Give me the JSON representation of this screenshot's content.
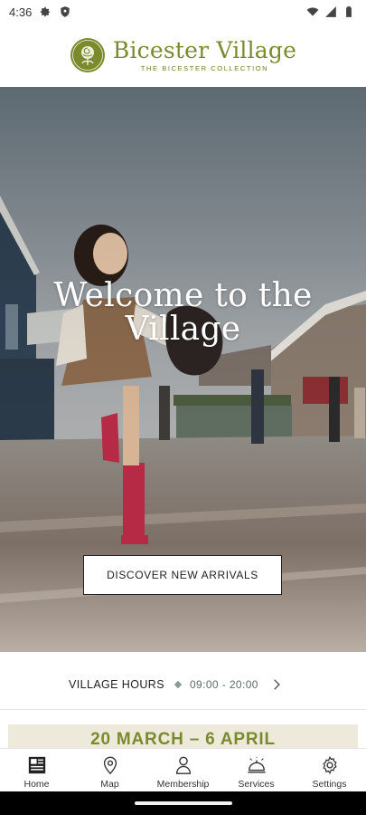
{
  "status_bar": {
    "time": "4:36",
    "left_icons": [
      "gear-icon",
      "shield-icon"
    ],
    "right_icons": [
      "wifi-icon",
      "signal-icon",
      "battery-icon"
    ]
  },
  "header": {
    "brand_name": "Bicester Village",
    "brand_sub": "THE BICESTER COLLECTION",
    "brand_color": "#7a8b2e"
  },
  "hero": {
    "title": "Welcome to the Village",
    "cta_label": "DISCOVER NEW ARRIVALS"
  },
  "hours": {
    "label": "VILLAGE HOURS",
    "value": "09:00 - 20:00"
  },
  "promo": {
    "text": "20 MARCH – 6 APRIL",
    "background": "#eeeadb"
  },
  "bottom_nav": {
    "items": [
      {
        "label": "Home",
        "icon": "newspaper-icon",
        "active": true
      },
      {
        "label": "Map",
        "icon": "map-pin-icon"
      },
      {
        "label": "Membership",
        "icon": "person-icon"
      },
      {
        "label": "Services",
        "icon": "service-bell-icon"
      },
      {
        "label": "Settings",
        "icon": "gear-icon"
      }
    ]
  }
}
